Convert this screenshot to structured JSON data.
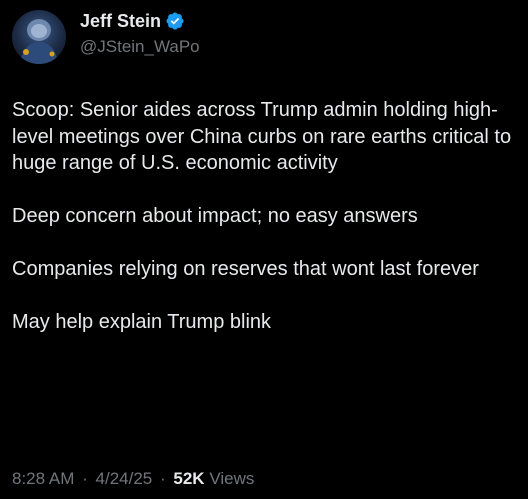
{
  "author": {
    "display_name": "Jeff Stein",
    "handle": "@JStein_WaPo",
    "verified_color": "#1d9bf0",
    "avatar_icon": "profile-avatar"
  },
  "tweet": {
    "paragraphs": [
      "Scoop: Senior aides across Trump admin holding high-level meetings over China curbs on rare earths critical to huge range of U.S. economic activity",
      "Deep concern about impact; no easy answers",
      "Companies relying on reserves that wont last forever",
      "May help explain Trump blink"
    ]
  },
  "meta": {
    "time": "8:28 AM",
    "separator": "·",
    "date": "4/24/25",
    "views_count": "52K",
    "views_label": "Views"
  },
  "colors": {
    "background": "#000000",
    "text": "#e7e9ea",
    "muted": "#71767b"
  }
}
